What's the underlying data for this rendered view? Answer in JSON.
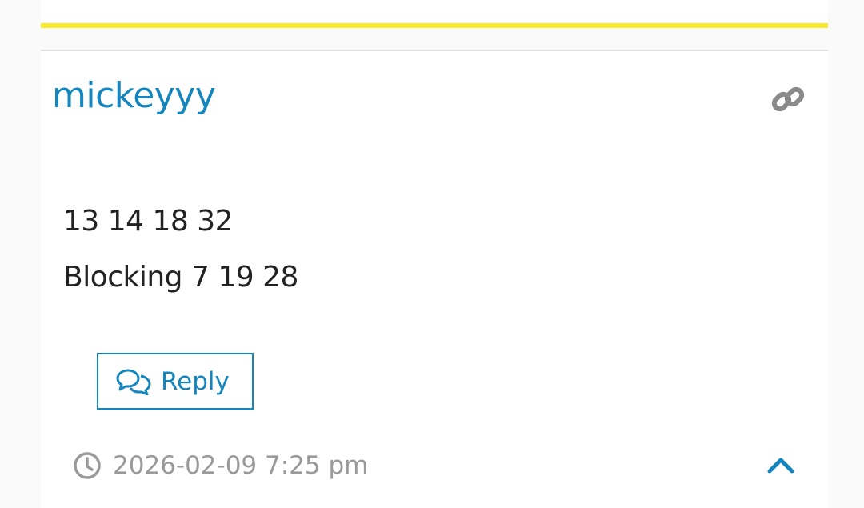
{
  "colors": {
    "accent": "#1486bd",
    "highlight_bar": "#fbea2c",
    "muted_text": "#9a9a9a",
    "body_text": "#222222"
  },
  "post": {
    "author": "mickeyyy",
    "permalink_icon": "link-icon",
    "content_lines": [
      "13 14 18 32",
      "Blocking 7 19 28"
    ],
    "reply_label": "Reply",
    "reply_icon": "comments-icon",
    "timestamp": "2026-02-09 7:25 pm",
    "timestamp_icon": "clock-icon",
    "collapse_icon": "chevron-up-icon"
  }
}
